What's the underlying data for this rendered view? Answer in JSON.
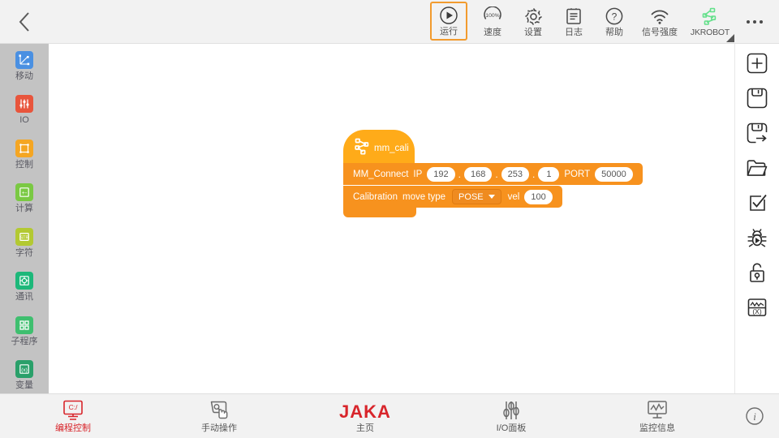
{
  "topbar": {
    "back_icon": "chevron-left-icon",
    "items": [
      {
        "id": "run",
        "label": "运行",
        "icon": "play-circle-icon",
        "active": true
      },
      {
        "id": "speed",
        "label": "速度",
        "icon": "speed-100-icon",
        "value": "100%"
      },
      {
        "id": "settings",
        "label": "设置",
        "icon": "gear-icon"
      },
      {
        "id": "log",
        "label": "日志",
        "icon": "clipboard-icon"
      },
      {
        "id": "help",
        "label": "帮助",
        "icon": "question-circle-icon"
      },
      {
        "id": "signal",
        "label": "信号强度",
        "icon": "wifi-icon"
      },
      {
        "id": "robot",
        "label": "JKROBOT",
        "icon": "robot-arm-icon"
      }
    ],
    "more_label": "more-menu"
  },
  "sidebar": {
    "items": [
      {
        "label": "移动",
        "icon": "move-axis-icon",
        "color": "#4a90e2"
      },
      {
        "label": "IO",
        "icon": "io-sliders-icon",
        "color": "#e8553c"
      },
      {
        "label": "控制",
        "icon": "control-square-icon",
        "color": "#f5a623"
      },
      {
        "label": "计算",
        "icon": "calculator-icon",
        "color": "#7ac943"
      },
      {
        "label": "字符",
        "icon": "string-icon",
        "color": "#b3c932"
      },
      {
        "label": "通讯",
        "icon": "comm-icon",
        "color": "#1db87a"
      },
      {
        "label": "子程序",
        "icon": "subprogram-icon",
        "color": "#3fbf6f"
      },
      {
        "label": "变量",
        "icon": "variable-icon",
        "color": "#2aa06a"
      }
    ]
  },
  "canvas": {
    "program": {
      "hat": {
        "label": "mm_cali",
        "icon": "robot-arm-icon"
      },
      "rows": [
        {
          "id": "mm-connect",
          "segments": [
            {
              "type": "label",
              "text": "MM_Connect"
            },
            {
              "type": "label",
              "text": "IP"
            },
            {
              "type": "oval",
              "text": "192"
            },
            {
              "type": "sep",
              "text": "."
            },
            {
              "type": "oval",
              "text": "168"
            },
            {
              "type": "sep",
              "text": "."
            },
            {
              "type": "oval",
              "text": "253"
            },
            {
              "type": "sep",
              "text": "."
            },
            {
              "type": "oval",
              "text": "1"
            },
            {
              "type": "label",
              "text": "PORT"
            },
            {
              "type": "oval",
              "text": "50000"
            }
          ]
        },
        {
          "id": "calibration",
          "segments": [
            {
              "type": "label",
              "text": "Calibration"
            },
            {
              "type": "label",
              "text": "move type"
            },
            {
              "type": "dropdown",
              "text": "POSE"
            },
            {
              "type": "label",
              "text": "vel"
            },
            {
              "type": "oval",
              "text": "100"
            }
          ]
        }
      ]
    },
    "collapse_handle": "chevron-down-icon"
  },
  "rightbar": {
    "buttons": [
      {
        "id": "new",
        "icon": "plus-square-icon"
      },
      {
        "id": "save",
        "icon": "save-icon"
      },
      {
        "id": "save-as",
        "icon": "save-as-arrow-icon"
      },
      {
        "id": "open",
        "icon": "folder-icon"
      },
      {
        "id": "verify",
        "icon": "check-square-icon"
      },
      {
        "id": "debug",
        "icon": "bug-icon"
      },
      {
        "id": "lock",
        "icon": "unlock-icon"
      },
      {
        "id": "variables",
        "icon": "variable-monitor-icon"
      }
    ]
  },
  "bottombar": {
    "items": [
      {
        "id": "program",
        "label": "编程控制",
        "icon": "monitor-cmd-icon",
        "active": true
      },
      {
        "id": "manual",
        "label": "手动操作",
        "icon": "hand-touch-icon",
        "active": false
      },
      {
        "id": "home",
        "label": "主页",
        "icon": "jaka-logo",
        "logo": "JAKA",
        "active": false
      },
      {
        "id": "io-panel",
        "label": "I/O面板",
        "icon": "io-sliders-icon",
        "active": false
      },
      {
        "id": "monitor",
        "label": "监控信息",
        "icon": "monitor-wave-icon",
        "active": false
      }
    ],
    "info_icon": "info-circle-icon"
  },
  "colors": {
    "accent_orange": "#f7921e",
    "hat_orange": "#ffab19",
    "brand_red": "#d8252b",
    "sidebar_gray": "#c3c3c3",
    "bar_gray": "#f2f2f2",
    "run_border": "#f29b2e"
  }
}
